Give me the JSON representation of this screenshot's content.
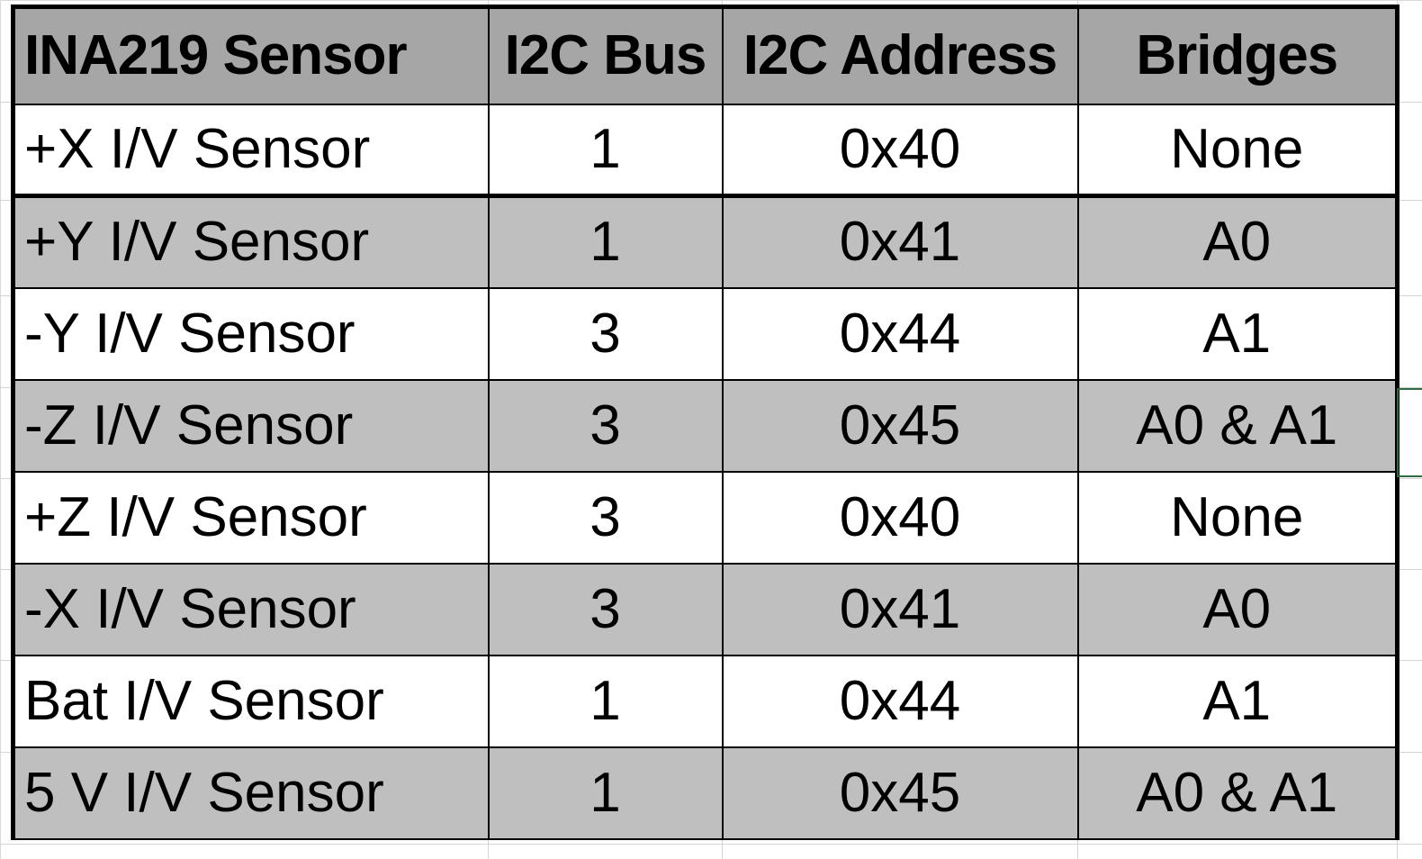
{
  "table": {
    "headers": [
      "INA219 Sensor",
      "I2C Bus",
      "I2C Address",
      "Bridges"
    ],
    "rows": [
      {
        "sensor": "+X I/V Sensor",
        "bus": "1",
        "address": "0x40",
        "bridges": "None"
      },
      {
        "sensor": "+Y I/V Sensor",
        "bus": "1",
        "address": "0x41",
        "bridges": "A0"
      },
      {
        "sensor": "-Y I/V Sensor",
        "bus": "3",
        "address": "0x44",
        "bridges": "A1"
      },
      {
        "sensor": "-Z I/V Sensor",
        "bus": "3",
        "address": "0x45",
        "bridges": "A0 & A1"
      },
      {
        "sensor": "+Z I/V Sensor",
        "bus": "3",
        "address": "0x40",
        "bridges": "None"
      },
      {
        "sensor": "-X I/V Sensor",
        "bus": "3",
        "address": "0x41",
        "bridges": "A0"
      },
      {
        "sensor": "Bat I/V Sensor",
        "bus": "1",
        "address": "0x44",
        "bridges": "A1"
      },
      {
        "sensor": "5 V I/V Sensor",
        "bus": "1",
        "address": "0x45",
        "bridges": "A0 & A1"
      }
    ]
  },
  "colors": {
    "header_fill": "#a6a6a6",
    "shaded_row_fill": "#bfbfbf",
    "plain_row_fill": "#ffffff",
    "border": "#000000",
    "selection_border": "#2e6b43"
  }
}
